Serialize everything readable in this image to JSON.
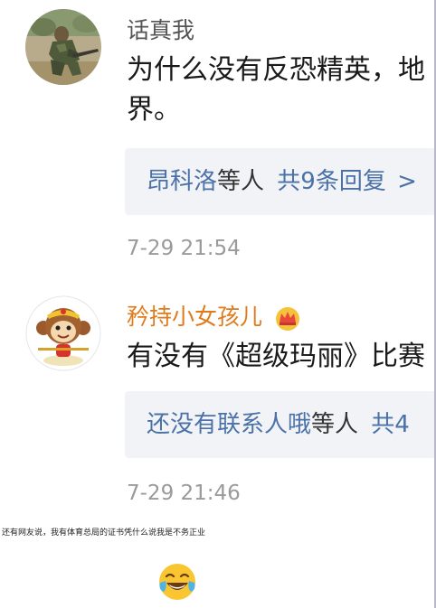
{
  "comments": [
    {
      "username": "话真我",
      "username_color": "#555555",
      "text_line1": "为什么没有反恐精英，地",
      "text_line2": "界。",
      "reply_summary": {
        "link_name": "昂科洛",
        "middle": "等人",
        "link_count": "共9条回复",
        "chevron": ">"
      },
      "timestamp": "7-29 21:54",
      "avatar_icon": "soldier-photo"
    },
    {
      "username": "矜持小女孩儿",
      "username_color": "#e07b1c",
      "badge_icon": "crown-badge",
      "text_line1": "有没有《超级玛丽》比赛",
      "reply_summary": {
        "link_name": "还没有联系人哦",
        "middle": "等人",
        "link_count": "共4"
      },
      "timestamp": "7-29 21:46",
      "avatar_icon": "monkey-king-cartoon"
    }
  ],
  "caption": "还有网友说，我有体育总局的证书凭什么说我是不务正业",
  "emoji_icon": "tears-of-joy-emoji",
  "colors": {
    "link": "#4a72a8",
    "timestamp": "#9a9a9a",
    "reply_bg": "#f2f3f6"
  }
}
